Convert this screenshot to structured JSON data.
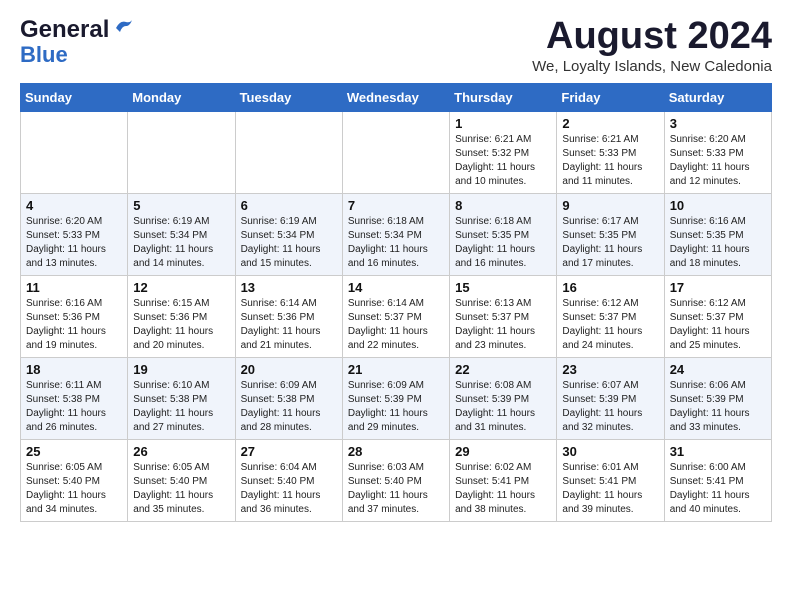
{
  "header": {
    "logo_general": "General",
    "logo_blue": "Blue",
    "month_title": "August 2024",
    "location": "We, Loyalty Islands, New Caledonia"
  },
  "days_of_week": [
    "Sunday",
    "Monday",
    "Tuesday",
    "Wednesday",
    "Thursday",
    "Friday",
    "Saturday"
  ],
  "weeks": [
    {
      "days": [
        {
          "num": "",
          "info": ""
        },
        {
          "num": "",
          "info": ""
        },
        {
          "num": "",
          "info": ""
        },
        {
          "num": "",
          "info": ""
        },
        {
          "num": "1",
          "sunrise": "Sunrise: 6:21 AM",
          "sunset": "Sunset: 5:32 PM",
          "daylight": "Daylight: 11 hours and 10 minutes."
        },
        {
          "num": "2",
          "sunrise": "Sunrise: 6:21 AM",
          "sunset": "Sunset: 5:33 PM",
          "daylight": "Daylight: 11 hours and 11 minutes."
        },
        {
          "num": "3",
          "sunrise": "Sunrise: 6:20 AM",
          "sunset": "Sunset: 5:33 PM",
          "daylight": "Daylight: 11 hours and 12 minutes."
        }
      ]
    },
    {
      "days": [
        {
          "num": "4",
          "sunrise": "Sunrise: 6:20 AM",
          "sunset": "Sunset: 5:33 PM",
          "daylight": "Daylight: 11 hours and 13 minutes."
        },
        {
          "num": "5",
          "sunrise": "Sunrise: 6:19 AM",
          "sunset": "Sunset: 5:34 PM",
          "daylight": "Daylight: 11 hours and 14 minutes."
        },
        {
          "num": "6",
          "sunrise": "Sunrise: 6:19 AM",
          "sunset": "Sunset: 5:34 PM",
          "daylight": "Daylight: 11 hours and 15 minutes."
        },
        {
          "num": "7",
          "sunrise": "Sunrise: 6:18 AM",
          "sunset": "Sunset: 5:34 PM",
          "daylight": "Daylight: 11 hours and 16 minutes."
        },
        {
          "num": "8",
          "sunrise": "Sunrise: 6:18 AM",
          "sunset": "Sunset: 5:35 PM",
          "daylight": "Daylight: 11 hours and 16 minutes."
        },
        {
          "num": "9",
          "sunrise": "Sunrise: 6:17 AM",
          "sunset": "Sunset: 5:35 PM",
          "daylight": "Daylight: 11 hours and 17 minutes."
        },
        {
          "num": "10",
          "sunrise": "Sunrise: 6:16 AM",
          "sunset": "Sunset: 5:35 PM",
          "daylight": "Daylight: 11 hours and 18 minutes."
        }
      ]
    },
    {
      "days": [
        {
          "num": "11",
          "sunrise": "Sunrise: 6:16 AM",
          "sunset": "Sunset: 5:36 PM",
          "daylight": "Daylight: 11 hours and 19 minutes."
        },
        {
          "num": "12",
          "sunrise": "Sunrise: 6:15 AM",
          "sunset": "Sunset: 5:36 PM",
          "daylight": "Daylight: 11 hours and 20 minutes."
        },
        {
          "num": "13",
          "sunrise": "Sunrise: 6:14 AM",
          "sunset": "Sunset: 5:36 PM",
          "daylight": "Daylight: 11 hours and 21 minutes."
        },
        {
          "num": "14",
          "sunrise": "Sunrise: 6:14 AM",
          "sunset": "Sunset: 5:37 PM",
          "daylight": "Daylight: 11 hours and 22 minutes."
        },
        {
          "num": "15",
          "sunrise": "Sunrise: 6:13 AM",
          "sunset": "Sunset: 5:37 PM",
          "daylight": "Daylight: 11 hours and 23 minutes."
        },
        {
          "num": "16",
          "sunrise": "Sunrise: 6:12 AM",
          "sunset": "Sunset: 5:37 PM",
          "daylight": "Daylight: 11 hours and 24 minutes."
        },
        {
          "num": "17",
          "sunrise": "Sunrise: 6:12 AM",
          "sunset": "Sunset: 5:37 PM",
          "daylight": "Daylight: 11 hours and 25 minutes."
        }
      ]
    },
    {
      "days": [
        {
          "num": "18",
          "sunrise": "Sunrise: 6:11 AM",
          "sunset": "Sunset: 5:38 PM",
          "daylight": "Daylight: 11 hours and 26 minutes."
        },
        {
          "num": "19",
          "sunrise": "Sunrise: 6:10 AM",
          "sunset": "Sunset: 5:38 PM",
          "daylight": "Daylight: 11 hours and 27 minutes."
        },
        {
          "num": "20",
          "sunrise": "Sunrise: 6:09 AM",
          "sunset": "Sunset: 5:38 PM",
          "daylight": "Daylight: 11 hours and 28 minutes."
        },
        {
          "num": "21",
          "sunrise": "Sunrise: 6:09 AM",
          "sunset": "Sunset: 5:39 PM",
          "daylight": "Daylight: 11 hours and 29 minutes."
        },
        {
          "num": "22",
          "sunrise": "Sunrise: 6:08 AM",
          "sunset": "Sunset: 5:39 PM",
          "daylight": "Daylight: 11 hours and 31 minutes."
        },
        {
          "num": "23",
          "sunrise": "Sunrise: 6:07 AM",
          "sunset": "Sunset: 5:39 PM",
          "daylight": "Daylight: 11 hours and 32 minutes."
        },
        {
          "num": "24",
          "sunrise": "Sunrise: 6:06 AM",
          "sunset": "Sunset: 5:39 PM",
          "daylight": "Daylight: 11 hours and 33 minutes."
        }
      ]
    },
    {
      "days": [
        {
          "num": "25",
          "sunrise": "Sunrise: 6:05 AM",
          "sunset": "Sunset: 5:40 PM",
          "daylight": "Daylight: 11 hours and 34 minutes."
        },
        {
          "num": "26",
          "sunrise": "Sunrise: 6:05 AM",
          "sunset": "Sunset: 5:40 PM",
          "daylight": "Daylight: 11 hours and 35 minutes."
        },
        {
          "num": "27",
          "sunrise": "Sunrise: 6:04 AM",
          "sunset": "Sunset: 5:40 PM",
          "daylight": "Daylight: 11 hours and 36 minutes."
        },
        {
          "num": "28",
          "sunrise": "Sunrise: 6:03 AM",
          "sunset": "Sunset: 5:40 PM",
          "daylight": "Daylight: 11 hours and 37 minutes."
        },
        {
          "num": "29",
          "sunrise": "Sunrise: 6:02 AM",
          "sunset": "Sunset: 5:41 PM",
          "daylight": "Daylight: 11 hours and 38 minutes."
        },
        {
          "num": "30",
          "sunrise": "Sunrise: 6:01 AM",
          "sunset": "Sunset: 5:41 PM",
          "daylight": "Daylight: 11 hours and 39 minutes."
        },
        {
          "num": "31",
          "sunrise": "Sunrise: 6:00 AM",
          "sunset": "Sunset: 5:41 PM",
          "daylight": "Daylight: 11 hours and 40 minutes."
        }
      ]
    }
  ]
}
